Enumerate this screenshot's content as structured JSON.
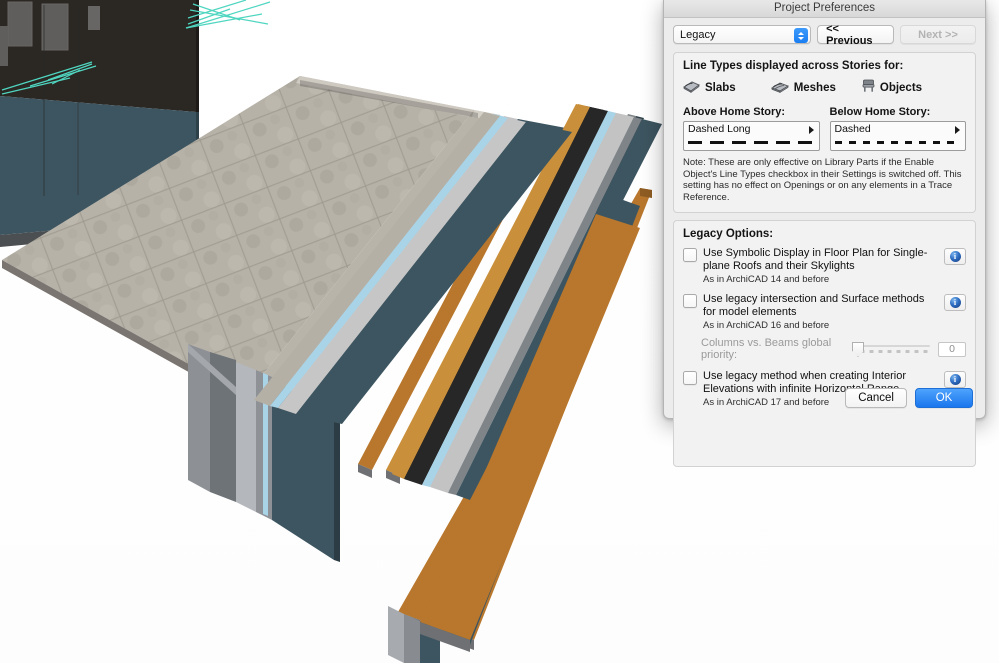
{
  "dialog": {
    "title": "Project Preferences",
    "scheme_popup": {
      "value": "Legacy",
      "icon": "chevron-updown-icon"
    },
    "previous_button": {
      "label": "<< Previous",
      "enabled": true
    },
    "next_button": {
      "label": "Next >>",
      "enabled": false
    },
    "line_types_section": {
      "title": "Line Types displayed across Stories for:",
      "element_tabs": [
        {
          "label": "Slabs",
          "icon": "slab-icon"
        },
        {
          "label": "Meshes",
          "icon": "mesh-icon"
        },
        {
          "label": "Objects",
          "icon": "object-chair-icon"
        }
      ],
      "above_home_story": {
        "label": "Above Home Story:",
        "value": "Dashed Long",
        "pattern": "dash-long"
      },
      "below_home_story": {
        "label": "Below Home Story:",
        "value": "Dashed",
        "pattern": "dash-short"
      },
      "note": "Note: These are only effective on Library Parts if the Enable Object's Line Types checkbox in their Settings is switched off. This setting has no effect on Openings or on any elements in a Trace Reference."
    },
    "legacy_options": {
      "title": "Legacy Options:",
      "items": [
        {
          "label": "Use Symbolic Display in Floor Plan for Single-plane Roofs and their Skylights",
          "sublabel": "As in ArchiCAD 14 and before",
          "checked": false,
          "info_icon": "info-icon"
        },
        {
          "label": "Use legacy intersection and Surface methods for model elements",
          "sublabel": "As in ArchiCAD 16 and before",
          "checked": false,
          "info_icon": "info-icon"
        },
        {
          "label": "Use legacy method when creating Interior Elevations with infinite Horizontal Range",
          "sublabel": "As in ArchiCAD 17 and before",
          "checked": false,
          "info_icon": "info-icon"
        }
      ],
      "priority_slider": {
        "label": "Columns vs. Beams global priority:",
        "value": "0",
        "enabled": false
      }
    },
    "footer": {
      "cancel_label": "Cancel",
      "ok_label": "OK"
    },
    "colors": {
      "accent_blue": "#1a76ee",
      "dialog_bg": "#ececec",
      "panel_bg": "#f2f2f2"
    }
  },
  "viewport": {
    "name": "3d-model-view",
    "background": "#ffffff",
    "colors": {
      "wall_face": "#3d5560",
      "wall_face_dark": "#2c3c45",
      "concrete": "#b5b0a6",
      "timber": "#b8772d",
      "timber_light": "#c98f3a",
      "insulation_blue": "#a9d4e8",
      "gypsum": "#c8c8c8",
      "steel_gray": "#7e8488",
      "edge_gray": "#5a6066",
      "dark_soffit": "#1c1c1c",
      "marker_teal": "#4fd6c0"
    }
  }
}
